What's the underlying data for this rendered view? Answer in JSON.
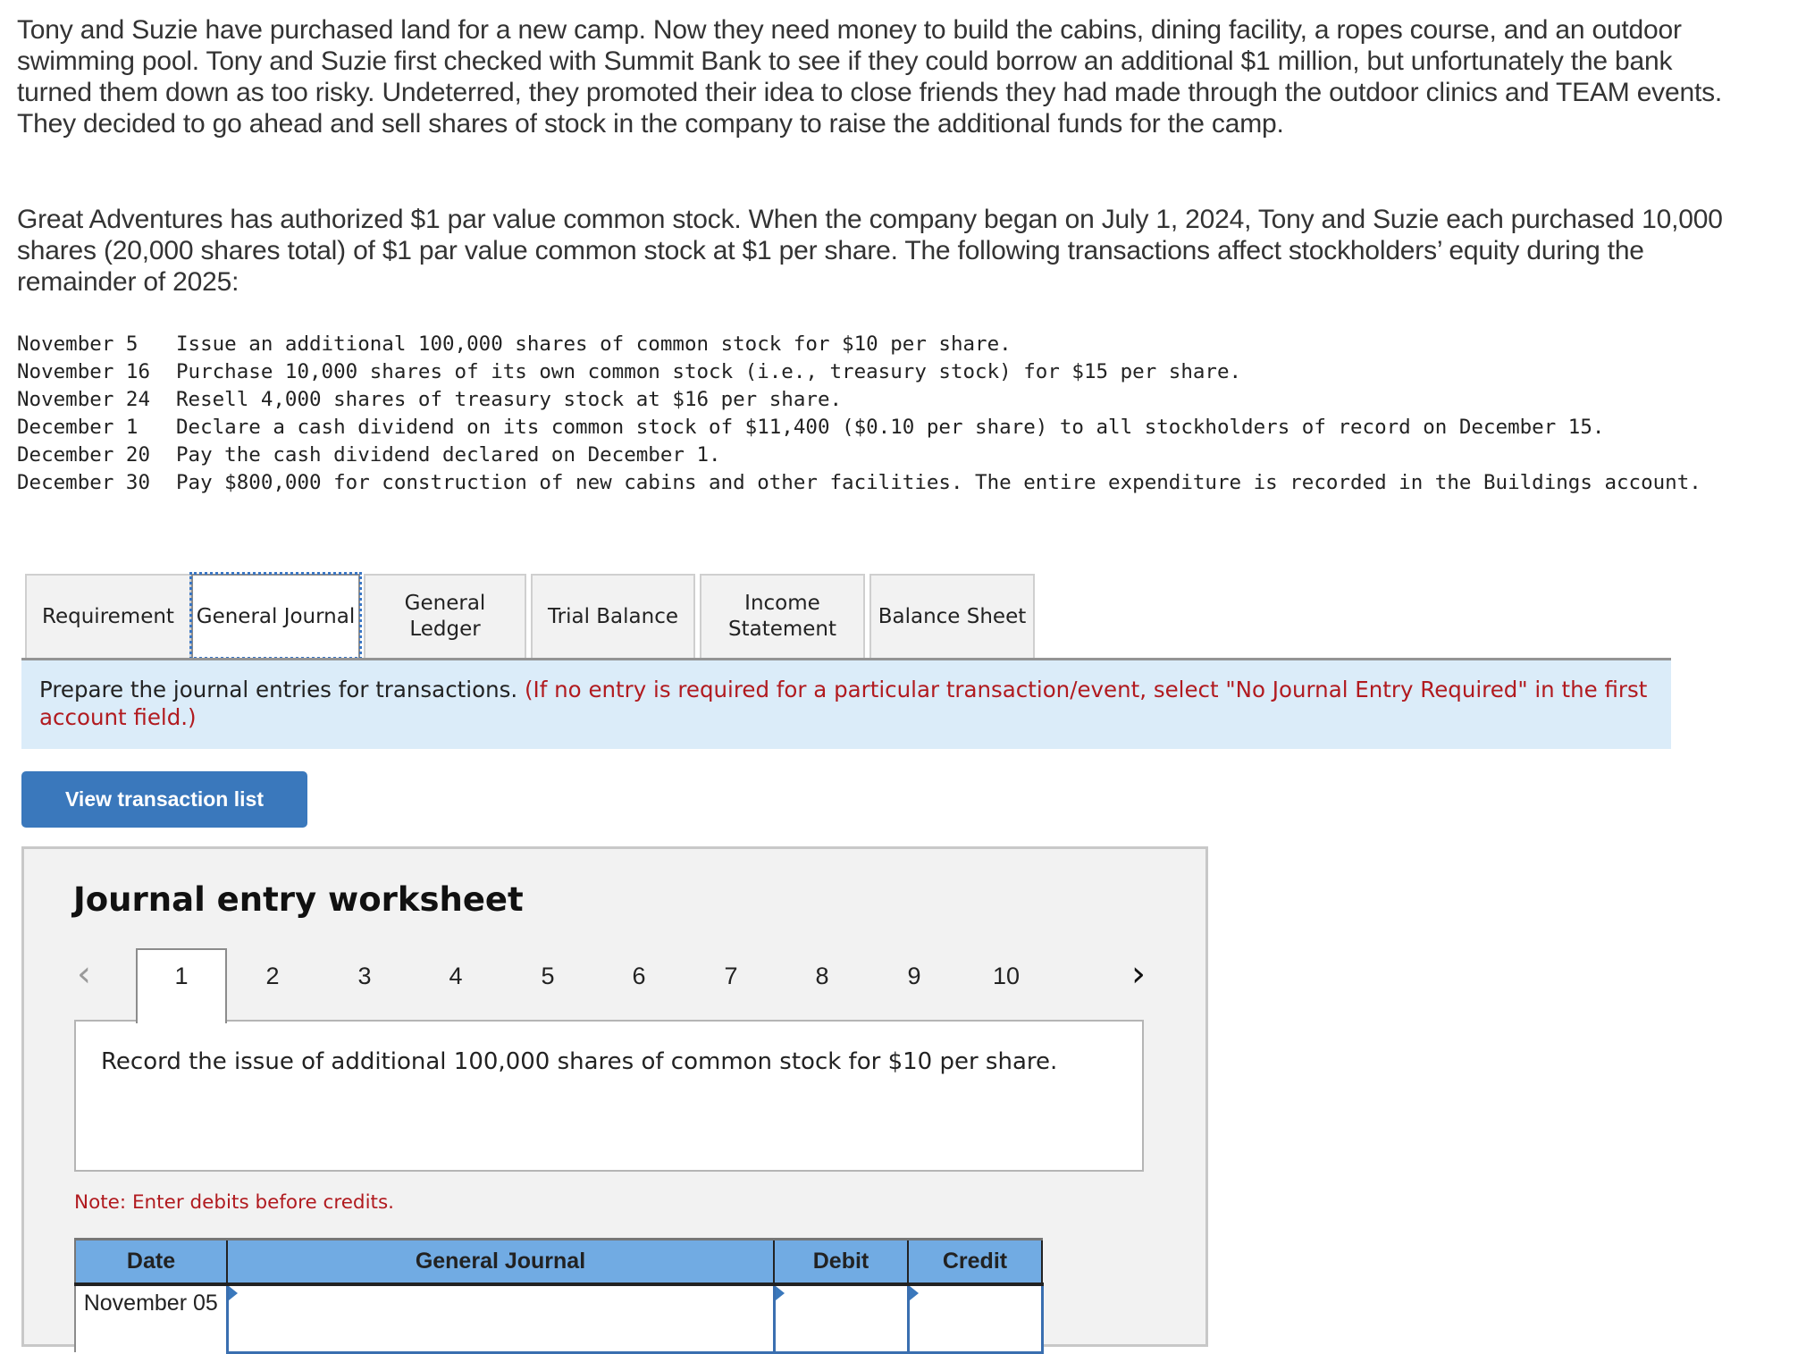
{
  "problem": {
    "paragraph1": "Tony and Suzie have purchased land for a new camp. Now they need money to build the cabins, dining facility, a ropes course, and an outdoor swimming pool. Tony and Suzie first checked with Summit Bank to see if they could borrow an additional $1 million, but unfortunately the bank turned them down as too risky. Undeterred, they promoted their idea to close friends they had made through the outdoor clinics and TEAM events. They decided to go ahead and sell shares of stock in the company to raise the additional funds for the camp.",
    "paragraph2": "Great Adventures has authorized $1 par value common stock. When the company began on July 1, 2024, Tony and Suzie each purchased 10,000 shares (20,000 shares total) of $1 par value common stock at $1 per share. The following transactions affect stockholders’ equity during the remainder of 2025:",
    "transactions": [
      {
        "date": "November 5",
        "description": "Issue an additional 100,000 shares of common stock for $10 per share."
      },
      {
        "date": "November 16",
        "description": "Purchase 10,000 shares of its own common stock (i.e., treasury stock) for $15 per share."
      },
      {
        "date": "November 24",
        "description": "Resell 4,000 shares of treasury stock at $16 per share."
      },
      {
        "date": "December 1",
        "description": "Declare a cash dividend on its common stock of $11,400 ($0.10 per share) to all stockholders of record on December 15."
      },
      {
        "date": "December 20",
        "description": "Pay the cash dividend declared on December 1."
      },
      {
        "date": "December 30",
        "description": "Pay $800,000 for construction of new cabins and other facilities. The entire expenditure is recorded in the Buildings account."
      }
    ]
  },
  "tabs": [
    {
      "label": "Requirement",
      "active": false
    },
    {
      "label": "General Journal",
      "active": true
    },
    {
      "label": "General Ledger",
      "active": false
    },
    {
      "label": "Trial Balance",
      "active": false
    },
    {
      "label": "Income Statement",
      "active": false
    },
    {
      "label": "Balance Sheet",
      "active": false
    }
  ],
  "instruction": {
    "main": "Prepare the journal entries for transactions. ",
    "note": "(If no entry is required for a particular transaction/event, select \"No Journal Entry Required\" in the first account field.)"
  },
  "view_transactions_button": "View transaction list",
  "worksheet": {
    "title": "Journal entry worksheet",
    "pages": [
      "1",
      "2",
      "3",
      "4",
      "5",
      "6",
      "7",
      "8",
      "9",
      "10"
    ],
    "active_page": "1",
    "prev_icon": "chevron-left-icon",
    "next_icon": "chevron-right-icon",
    "description": "Record the issue of additional 100,000 shares of common stock for $10 per share.",
    "note": "Note: Enter debits before credits.",
    "table": {
      "headers": {
        "date": "Date",
        "journal": "General Journal",
        "debit": "Debit",
        "credit": "Credit"
      },
      "rows": [
        {
          "date": "November 05",
          "account": "",
          "debit": "",
          "credit": ""
        }
      ]
    }
  },
  "colors": {
    "accent_button": "#3a78bc",
    "table_header": "#71abe3",
    "instruction_bg": "#dbecf9",
    "warning_text": "#b11a1f"
  }
}
